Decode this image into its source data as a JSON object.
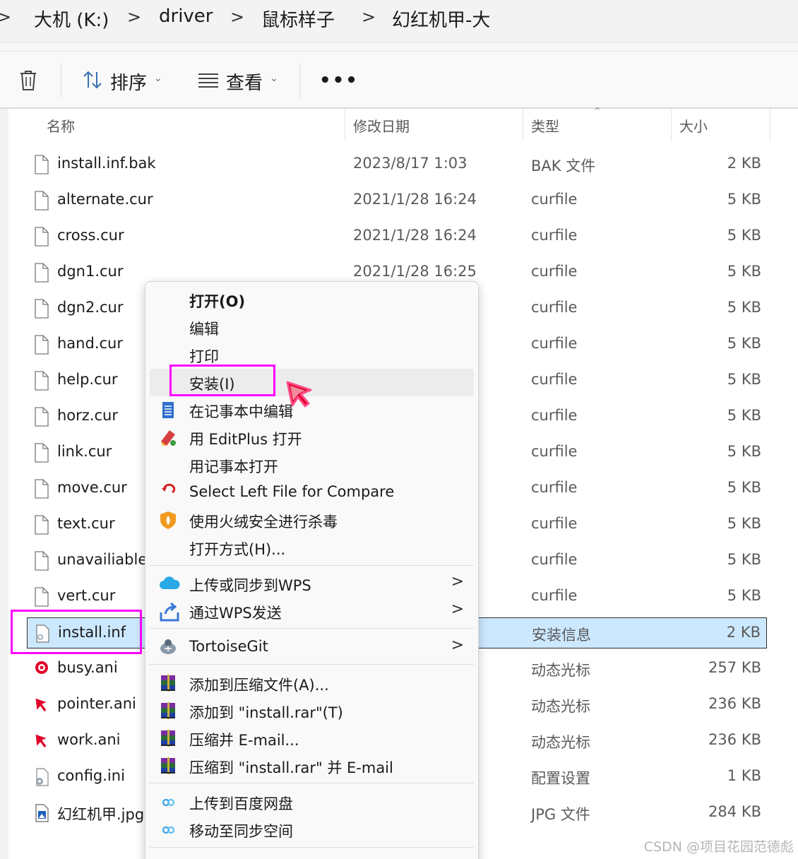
{
  "breadcrumb": {
    "items": [
      "大机 (K:)",
      "driver",
      "鼠标样子",
      "幻红机甲-大"
    ],
    "separator": ">"
  },
  "toolbar": {
    "delete_icon": "trash-icon",
    "sort_label": "排序",
    "view_label": "查看",
    "more_label": "•••"
  },
  "columns": {
    "name": "名称",
    "date": "修改日期",
    "type": "类型",
    "size": "大小"
  },
  "files": [
    {
      "name": "install.inf.bak",
      "date": "2023/8/17 1:03",
      "type": "BAK 文件",
      "size": "2 KB",
      "icon": "file-icon"
    },
    {
      "name": "alternate.cur",
      "date": "2021/1/28 16:24",
      "type": "curfile",
      "size": "5 KB",
      "icon": "file-icon"
    },
    {
      "name": "cross.cur",
      "date": "2021/1/28 16:24",
      "type": "curfile",
      "size": "5 KB",
      "icon": "file-icon"
    },
    {
      "name": "dgn1.cur",
      "date": "2021/1/28 16:25",
      "type": "curfile",
      "size": "5 KB",
      "icon": "file-icon"
    },
    {
      "name": "dgn2.cur",
      "date": "",
      "type": "curfile",
      "size": "5 KB",
      "icon": "file-icon"
    },
    {
      "name": "hand.cur",
      "date": "",
      "type": "curfile",
      "size": "5 KB",
      "icon": "file-icon"
    },
    {
      "name": "help.cur",
      "date": "",
      "type": "curfile",
      "size": "5 KB",
      "icon": "file-icon"
    },
    {
      "name": "horz.cur",
      "date": "",
      "type": "curfile",
      "size": "5 KB",
      "icon": "file-icon"
    },
    {
      "name": "link.cur",
      "date": "",
      "type": "curfile",
      "size": "5 KB",
      "icon": "file-icon"
    },
    {
      "name": "move.cur",
      "date": "",
      "type": "curfile",
      "size": "5 KB",
      "icon": "file-icon"
    },
    {
      "name": "text.cur",
      "date": "",
      "type": "curfile",
      "size": "5 KB",
      "icon": "file-icon"
    },
    {
      "name": "unavailiable",
      "date": "",
      "type": "curfile",
      "size": "5 KB",
      "icon": "file-icon"
    },
    {
      "name": "vert.cur",
      "date": "",
      "type": "curfile",
      "size": "5 KB",
      "icon": "file-icon"
    },
    {
      "name": "install.inf",
      "date": "",
      "type": "安装信息",
      "size": "2 KB",
      "icon": "setup-info-icon",
      "selected": true
    },
    {
      "name": "busy.ani",
      "date": "",
      "type": "动态光标",
      "size": "257 KB",
      "icon": "busy-cursor-icon"
    },
    {
      "name": "pointer.ani",
      "date": "",
      "type": "动态光标",
      "size": "236 KB",
      "icon": "pointer-cursor-icon"
    },
    {
      "name": "work.ani",
      "date": "",
      "type": "动态光标",
      "size": "236 KB",
      "icon": "work-cursor-icon"
    },
    {
      "name": "config.ini",
      "date": "",
      "type": "配置设置",
      "size": "1 KB",
      "icon": "config-icon"
    },
    {
      "name": "幻红机甲.jpg",
      "date": "",
      "type": "JPG 文件",
      "size": "284 KB",
      "icon": "image-file-icon"
    }
  ],
  "context_menu": {
    "items": [
      {
        "label": "打开(O)",
        "bold": true,
        "icon": ""
      },
      {
        "label": "编辑",
        "icon": ""
      },
      {
        "label": "打印",
        "icon": ""
      },
      {
        "label": "安装(I)",
        "icon": "",
        "hover": true
      },
      {
        "label": "在记事本中编辑",
        "icon": "notepad-icon"
      },
      {
        "label": "用 EditPlus 打开",
        "icon": "editplus-icon"
      },
      {
        "label": "用记事本打开",
        "icon": ""
      },
      {
        "label": "Select Left File for Compare",
        "icon": "compare-icon"
      },
      {
        "label": "使用火绒安全进行杀毒",
        "icon": "shield-icon"
      },
      {
        "label": "打开方式(H)...",
        "icon": ""
      },
      {
        "label": "上传或同步到WPS",
        "icon": "cloud-icon",
        "submenu": true
      },
      {
        "label": "通过WPS发送",
        "icon": "share-icon",
        "submenu": true
      },
      {
        "label": "TortoiseGit",
        "icon": "tortoisegit-icon",
        "submenu": true
      },
      {
        "label": "添加到压缩文件(A)...",
        "icon": "winrar-icon"
      },
      {
        "label": "添加到 \"install.rar\"(T)",
        "icon": "winrar-icon"
      },
      {
        "label": "压缩并 E-mail...",
        "icon": "winrar-icon"
      },
      {
        "label": "压缩到 \"install.rar\" 并 E-mail",
        "icon": "winrar-icon"
      },
      {
        "label": "上传到百度网盘",
        "icon": "baidu-netdisk-icon"
      },
      {
        "label": "移动至同步空间",
        "icon": "baidu-netdisk-icon"
      }
    ],
    "submenu_chevron": ">"
  },
  "watermark": "CSDN @项目花园范德彪",
  "colors": {
    "highlight": "#ff00ff",
    "selected_row": "#cce8ff",
    "cursor": "#e0002a"
  }
}
